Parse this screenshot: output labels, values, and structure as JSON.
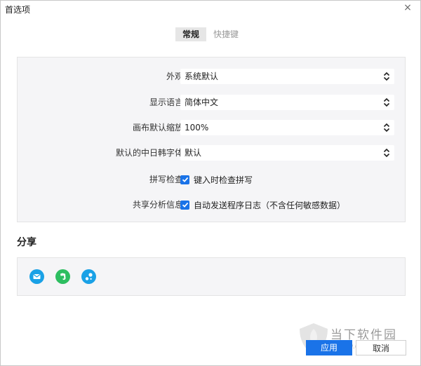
{
  "window": {
    "title": "首选项",
    "close_label": "×"
  },
  "tabs": [
    {
      "label": "常规",
      "active": true
    },
    {
      "label": "快捷键",
      "active": false
    }
  ],
  "settings": {
    "appearance": {
      "label": "外观:",
      "value": "系统默认"
    },
    "language": {
      "label": "显示语言:",
      "value": "简体中文"
    },
    "zoom": {
      "label": "画布默认缩放:",
      "value": "100%"
    },
    "cjk_font": {
      "label": "默认的中日韩字体:",
      "value": "默认"
    },
    "spellcheck": {
      "label": "拼写检查:",
      "option": "键入时检查拼写",
      "checked": true
    },
    "analytics": {
      "label": "共享分析信息:",
      "option": "自动发送程序日志（不含任何敏感数据）",
      "checked": true
    }
  },
  "share": {
    "title": "分享",
    "icons": [
      {
        "name": "mail-icon",
        "color": "#1aa1e6"
      },
      {
        "name": "evernote-icon",
        "color": "#2dbe60"
      },
      {
        "name": "share-link-icon",
        "color": "#1aa1e6"
      }
    ]
  },
  "footer": {
    "apply_label": "应用",
    "cancel_label": "取消"
  },
  "watermark": {
    "text": "当下软件园",
    "url": "www.downxia.com"
  },
  "colors": {
    "accent": "#1a73e8",
    "panel_bg": "#f5f5f7"
  }
}
